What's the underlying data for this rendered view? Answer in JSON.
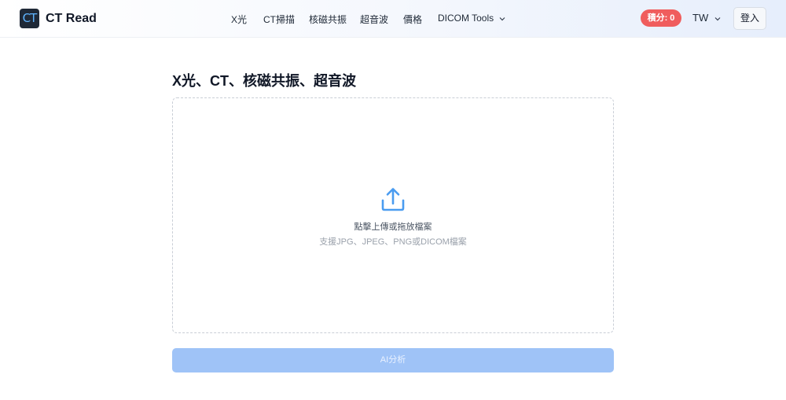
{
  "header": {
    "logo_mark": "CT",
    "logo_text": "CT Read",
    "nav": [
      {
        "label": "X光"
      },
      {
        "label": "CT掃描"
      },
      {
        "label": "核磁共振"
      },
      {
        "label": "超音波"
      },
      {
        "label": "價格"
      },
      {
        "label": "DICOM Tools"
      }
    ],
    "points_label": "積分: 0",
    "language": "TW",
    "login_label": "登入"
  },
  "main": {
    "title": "X光、CT、核磁共振、超音波",
    "upload": {
      "icon": "upload-icon",
      "primary_text": "點擊上傳或拖放檔案",
      "secondary_text": "支援JPG、JPEG、PNG或DICOM檔案"
    },
    "analyze_label": "AI分析"
  },
  "colors": {
    "accent": "#4a9cf0",
    "button_disabled": "#9fc3f7",
    "points_badge": "#f05d5d"
  }
}
